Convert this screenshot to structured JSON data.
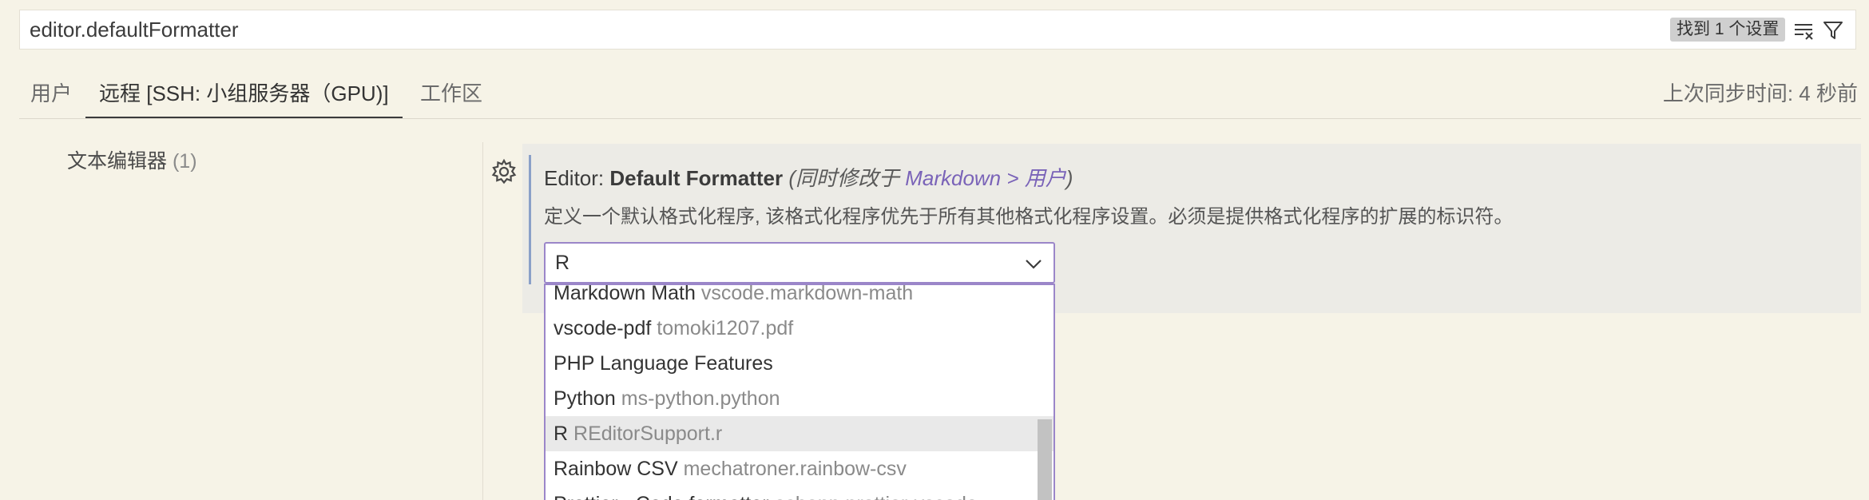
{
  "search": {
    "value": "editor.defaultFormatter",
    "result_count": "找到 1 个设置",
    "clear_filter_icon": "clear-filter-icon",
    "filter_icon": "filter-icon"
  },
  "tabs": [
    {
      "label": "用户",
      "active": false
    },
    {
      "label": "远程 [SSH: 小组服务器（GPU)]",
      "active": true
    },
    {
      "label": "工作区",
      "active": false
    }
  ],
  "sync_status": "上次同步时间: 4 秒前",
  "toc": {
    "label": "文本编辑器",
    "count": "(1)"
  },
  "setting": {
    "category": "Editor: ",
    "name": "Default Formatter",
    "modified_prefix": "(同时修改于 ",
    "modified_link": "Markdown > 用户",
    "modified_suffix": ")",
    "description": "定义一个默认格式化程序, 该格式化程序优先于所有其他格式化程序设置。必须是提供格式化程序的扩展的标识符。",
    "selected_value": "R"
  },
  "dropdown_options": [
    {
      "name": "Markdown Math",
      "id": "vscode.markdown-math",
      "selected": false
    },
    {
      "name": "vscode-pdf",
      "id": "tomoki1207.pdf",
      "selected": false
    },
    {
      "name": "PHP Language Features",
      "id": "",
      "selected": false
    },
    {
      "name": "Python",
      "id": "ms-python.python",
      "selected": false
    },
    {
      "name": "R",
      "id": "REditorSupport.r",
      "selected": true
    },
    {
      "name": "Rainbow CSV",
      "id": "mechatroner.rainbow-csv",
      "selected": false
    },
    {
      "name": "Prettier - Code formatter",
      "id": "esbenp.prettier-vscode",
      "selected": false
    }
  ],
  "colors": {
    "background": "#f6f3e7",
    "accent": "#9b86c9",
    "link": "#7a63b8",
    "focus_line": "#8aa0c8"
  }
}
